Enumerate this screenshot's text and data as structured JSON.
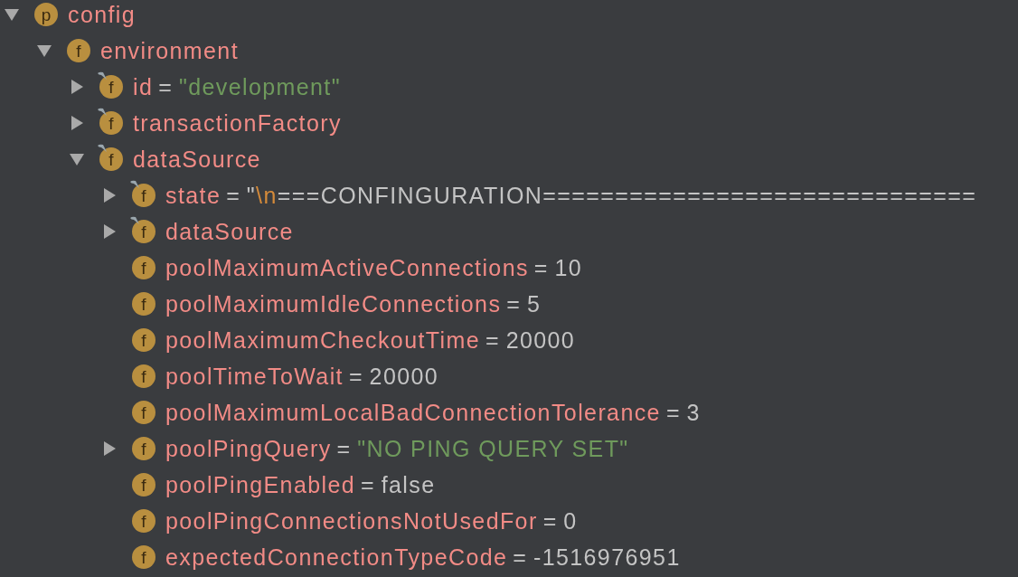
{
  "tree": [
    {
      "badge": "p",
      "marked": false,
      "name": "config",
      "expandable": true,
      "expanded": true,
      "children": [
        {
          "badge": "f",
          "marked": false,
          "name": "environment",
          "expandable": true,
          "expanded": true,
          "children": [
            {
              "badge": "f",
              "marked": true,
              "name": "id",
              "expandable": true,
              "expanded": false,
              "separator": "=",
              "value": [
                {
                  "kind": "string",
                  "text": "\"development\""
                }
              ]
            },
            {
              "badge": "f",
              "marked": true,
              "name": "transactionFactory",
              "expandable": true,
              "expanded": false
            },
            {
              "badge": "f",
              "marked": true,
              "name": "dataSource",
              "expandable": true,
              "expanded": true,
              "children": [
                {
                  "badge": "f",
                  "marked": true,
                  "name": "state",
                  "expandable": true,
                  "expanded": false,
                  "separator": "=",
                  "value": [
                    {
                      "kind": "plain",
                      "text": "\""
                    },
                    {
                      "kind": "escape",
                      "text": "\\n"
                    },
                    {
                      "kind": "plain",
                      "text": "===CONFINGURATION=============================="
                    }
                  ]
                },
                {
                  "badge": "f",
                  "marked": true,
                  "name": "dataSource",
                  "expandable": true,
                  "expanded": false
                },
                {
                  "badge": "f",
                  "marked": false,
                  "name": "poolMaximumActiveConnections",
                  "expandable": false,
                  "separator": "=",
                  "value": [
                    {
                      "kind": "plain",
                      "text": "10"
                    }
                  ]
                },
                {
                  "badge": "f",
                  "marked": false,
                  "name": "poolMaximumIdleConnections",
                  "expandable": false,
                  "separator": "=",
                  "value": [
                    {
                      "kind": "plain",
                      "text": "5"
                    }
                  ]
                },
                {
                  "badge": "f",
                  "marked": false,
                  "name": "poolMaximumCheckoutTime",
                  "expandable": false,
                  "separator": "=",
                  "value": [
                    {
                      "kind": "plain",
                      "text": "20000"
                    }
                  ]
                },
                {
                  "badge": "f",
                  "marked": false,
                  "name": "poolTimeToWait",
                  "expandable": false,
                  "separator": "=",
                  "value": [
                    {
                      "kind": "plain",
                      "text": "20000"
                    }
                  ]
                },
                {
                  "badge": "f",
                  "marked": false,
                  "name": "poolMaximumLocalBadConnectionTolerance",
                  "expandable": false,
                  "separator": "=",
                  "value": [
                    {
                      "kind": "plain",
                      "text": "3"
                    }
                  ]
                },
                {
                  "badge": "f",
                  "marked": false,
                  "name": "poolPingQuery",
                  "expandable": true,
                  "expanded": false,
                  "separator": "=",
                  "value": [
                    {
                      "kind": "string",
                      "text": "\"NO PING QUERY SET\""
                    }
                  ]
                },
                {
                  "badge": "f",
                  "marked": false,
                  "name": "poolPingEnabled",
                  "expandable": false,
                  "separator": "=",
                  "value": [
                    {
                      "kind": "plain",
                      "text": "false"
                    }
                  ]
                },
                {
                  "badge": "f",
                  "marked": false,
                  "name": "poolPingConnectionsNotUsedFor",
                  "expandable": false,
                  "separator": "=",
                  "value": [
                    {
                      "kind": "plain",
                      "text": "0"
                    }
                  ]
                },
                {
                  "badge": "f",
                  "marked": false,
                  "name": "expectedConnectionTypeCode",
                  "expandable": false,
                  "separator": "=",
                  "value": [
                    {
                      "kind": "plain",
                      "text": "-1516976951"
                    }
                  ]
                }
              ]
            }
          ]
        }
      ]
    }
  ]
}
